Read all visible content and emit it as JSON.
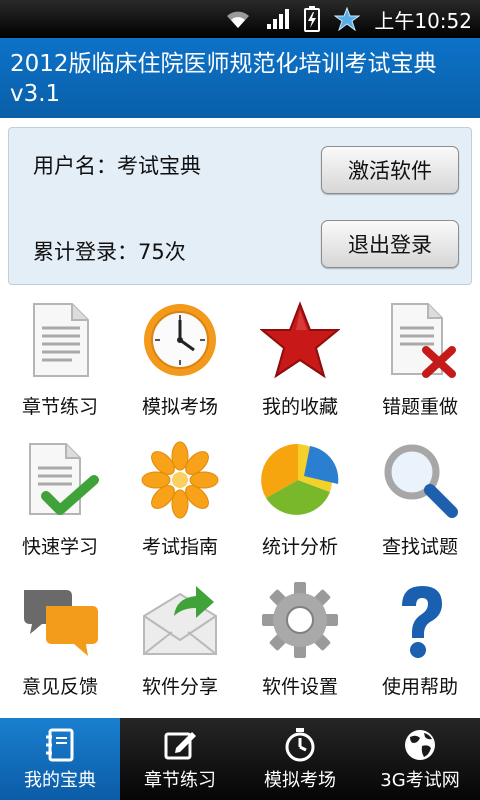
{
  "status_bar": {
    "time": "上午10:52",
    "icons": [
      "wifi-icon",
      "signal-icon",
      "battery-charging-icon",
      "star-icon"
    ]
  },
  "app": {
    "title": "2012版临床住院医师规范化培训考试宝典v3.1"
  },
  "user_panel": {
    "username_text": "用户名：考试宝典",
    "login_count_text": "累计登录：75次",
    "activate_label": "激活软件",
    "logout_label": "退出登录"
  },
  "grid": {
    "items": [
      {
        "label": "章节练习",
        "icon": "document-icon"
      },
      {
        "label": "模拟考场",
        "icon": "clock-icon"
      },
      {
        "label": "我的收藏",
        "icon": "star-icon"
      },
      {
        "label": "错题重做",
        "icon": "document-error-icon"
      },
      {
        "label": "快速学习",
        "icon": "document-check-icon"
      },
      {
        "label": "考试指南",
        "icon": "flower-icon"
      },
      {
        "label": "统计分析",
        "icon": "pie-chart-icon"
      },
      {
        "label": "查找试题",
        "icon": "magnifier-icon"
      },
      {
        "label": "意见反馈",
        "icon": "chat-bubbles-icon"
      },
      {
        "label": "软件分享",
        "icon": "mail-share-icon"
      },
      {
        "label": "软件设置",
        "icon": "gear-icon"
      },
      {
        "label": "使用帮助",
        "icon": "question-icon"
      }
    ]
  },
  "bottom_nav": {
    "items": [
      {
        "label": "我的宝典",
        "icon": "notebook-icon",
        "active": true
      },
      {
        "label": "章节练习",
        "icon": "edit-icon",
        "active": false
      },
      {
        "label": "模拟考场",
        "icon": "stopwatch-icon",
        "active": false
      },
      {
        "label": "3G考试网",
        "icon": "globe-icon",
        "active": false
      }
    ]
  },
  "colors": {
    "title_bar": "#0a66b8",
    "status_bar": "#000000",
    "panel_bg": "#e3eef7",
    "nav_active": "#1470c0"
  }
}
